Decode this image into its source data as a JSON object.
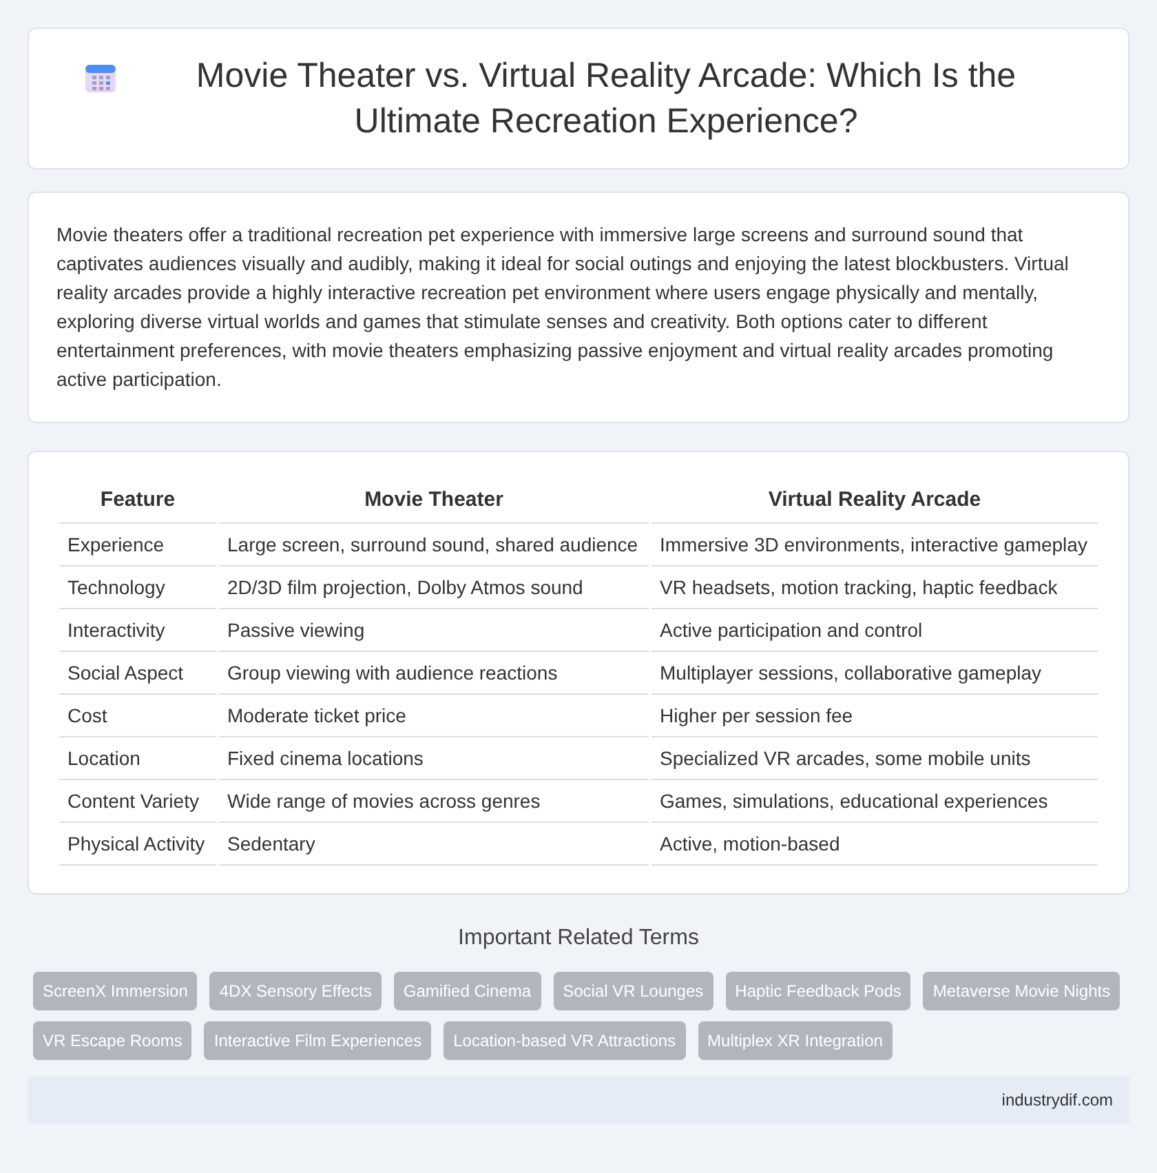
{
  "header": {
    "title": "Movie Theater vs. Virtual Reality Arcade: Which Is the Ultimate Recreation Experience?"
  },
  "intro": "Movie theaters offer a traditional recreation pet experience with immersive large screens and surround sound that captivates audiences visually and audibly, making it ideal for social outings and enjoying the latest blockbusters. Virtual reality arcades provide a highly interactive recreation pet environment where users engage physically and mentally, exploring diverse virtual worlds and games that stimulate senses and creativity. Both options cater to different entertainment preferences, with movie theaters emphasizing passive enjoyment and virtual reality arcades promoting active participation.",
  "table": {
    "columns": [
      "Feature",
      "Movie Theater",
      "Virtual Reality Arcade"
    ],
    "rows": [
      [
        "Experience",
        "Large screen, surround sound, shared audience",
        "Immersive 3D environments, interactive gameplay"
      ],
      [
        "Technology",
        "2D/3D film projection, Dolby Atmos sound",
        "VR headsets, motion tracking, haptic feedback"
      ],
      [
        "Interactivity",
        "Passive viewing",
        "Active participation and control"
      ],
      [
        "Social Aspect",
        "Group viewing with audience reactions",
        "Multiplayer sessions, collaborative gameplay"
      ],
      [
        "Cost",
        "Moderate ticket price",
        "Higher per session fee"
      ],
      [
        "Location",
        "Fixed cinema locations",
        "Specialized VR arcades, some mobile units"
      ],
      [
        "Content Variety",
        "Wide range of movies across genres",
        "Games, simulations, educational experiences"
      ],
      [
        "Physical Activity",
        "Sedentary",
        "Active, motion-based"
      ]
    ]
  },
  "related": {
    "title": "Important Related Terms",
    "tags": [
      "ScreenX Immersion",
      "4DX Sensory Effects",
      "Gamified Cinema",
      "Social VR Lounges",
      "Haptic Feedback Pods",
      "Metaverse Movie Nights",
      "VR Escape Rooms",
      "Interactive Film Experiences",
      "Location-based VR Attractions",
      "Multiplex XR Integration"
    ]
  },
  "footer": {
    "site": "industrydif.com"
  }
}
